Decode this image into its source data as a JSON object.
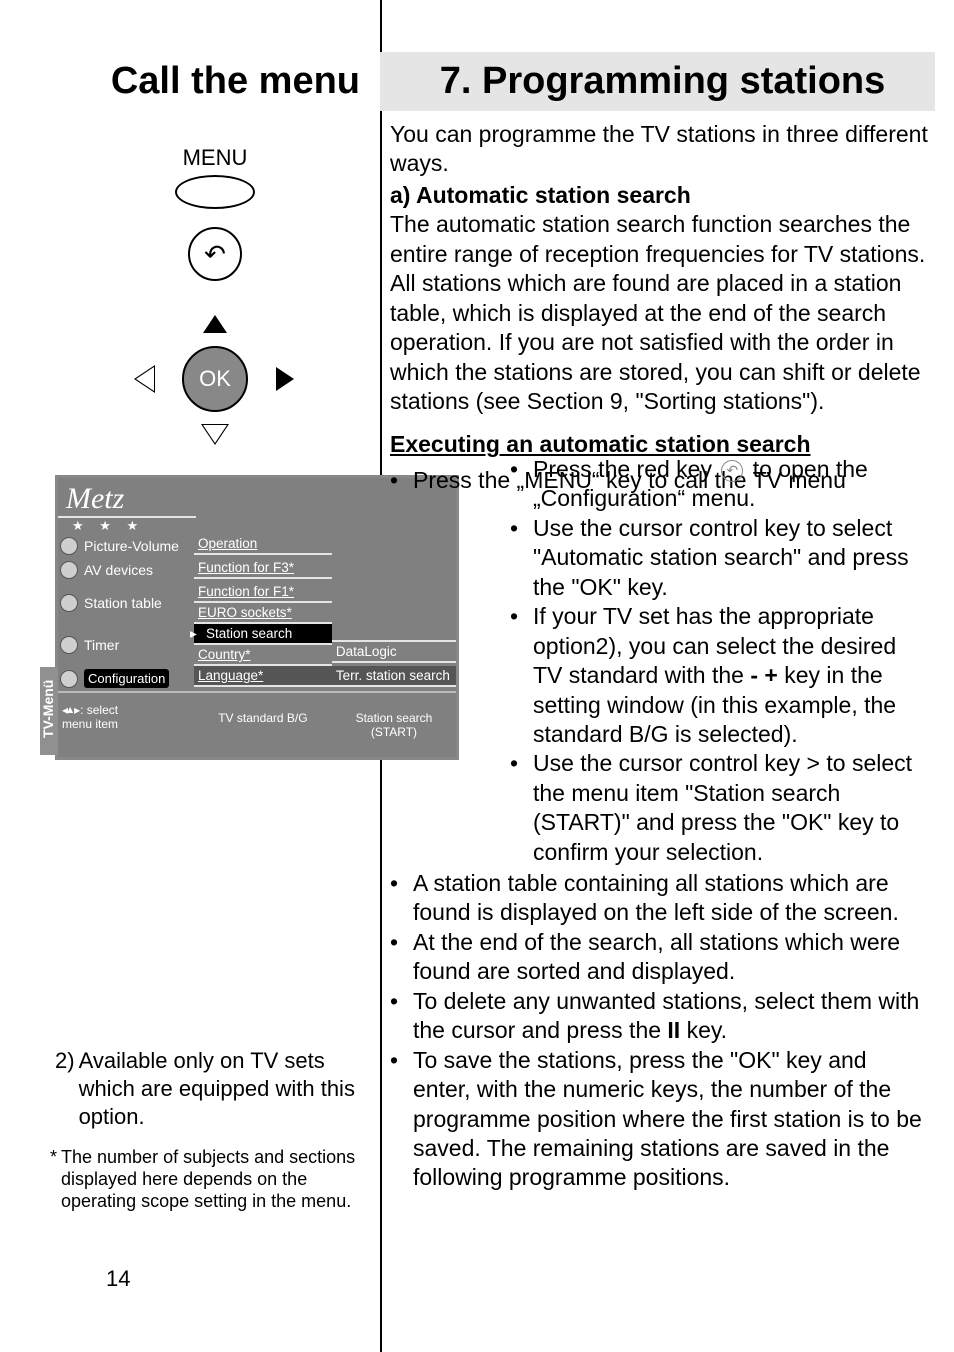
{
  "left_title": "Call the menu",
  "right_title": "7. Programming stations",
  "intro": "You can programme the TV stations in three different ways.",
  "a_header": "a) Automatic station search",
  "a_body": "The automatic station search function searches the entire range of reception frequencies for TV stations. All stations which are found are placed in a station table, which is displayed at the end of the search operation. If you are not satisfied with the order in which the stations are stored, you can shift or delete stations (see Section 9, \"Sorting stations\").",
  "exec_header": "Executing an automatic station search",
  "press_menu": "Press the „MENU“ key to call the TV menu",
  "bullets_inner": {
    "b1a": "Press the red key ",
    "b1b": " to open the „Configuration“ menu.",
    "b2": "Use the cursor control key to select \"Automatic station search\" and press the \"OK\" key.",
    "b3a": "If your TV set has the appropriate option2), you can select the desired TV standard with the ",
    "b3b": " key in the setting window (in this example, the standard B/G is selected).",
    "b4": "Use the cursor control key > to select the menu item \"Station search (START)\" and press the \"OK\" key to confirm your selection."
  },
  "bullets_lower": {
    "b5": "A station table containing all stations which are found is displayed on the left side of the screen.",
    "b6": "At the end of the search, all stations which were found are sorted and displayed.",
    "b7a": "To delete any unwanted stations, select them with the cursor and press the ",
    "b7b": " key.",
    "b8": "To save the stations, press the \"OK\" key and enter, with the numeric keys, the number of the programme position where the first station is to be saved. The remaining stations are saved in the following programme positions."
  },
  "keys": {
    "minus_plus": "- +",
    "ii": "II"
  },
  "remote": {
    "menu_label": "MENU",
    "ok": "OK"
  },
  "tvmenu": {
    "logo": "Metz",
    "tab": "TV-Menü",
    "left_items": {
      "pv": "Picture-Volume",
      "av": "AV devices",
      "st": "Station table",
      "timer": "Timer",
      "config": "Configuration"
    },
    "mid_items": {
      "op": "Operation",
      "f3": "Function for F3*",
      "f1": "Function for F1*",
      "euro": "EURO sockets*",
      "station": "Station search",
      "country": "Country*",
      "lang": "Language*"
    },
    "right_items": {
      "dl": "DataLogic",
      "terr": "Terr. station search"
    },
    "foot_l": "◂◂▸▸: select\nmenu item",
    "foot_m": "TV standard   B/G",
    "foot_r": "Station search  (START)"
  },
  "footnote2": "2) Available only on TV sets which are equipped with this option.",
  "footnote_star": "* The number of subjects and sections displayed here depends on the operating scope setting in the menu.",
  "page_num": "14"
}
